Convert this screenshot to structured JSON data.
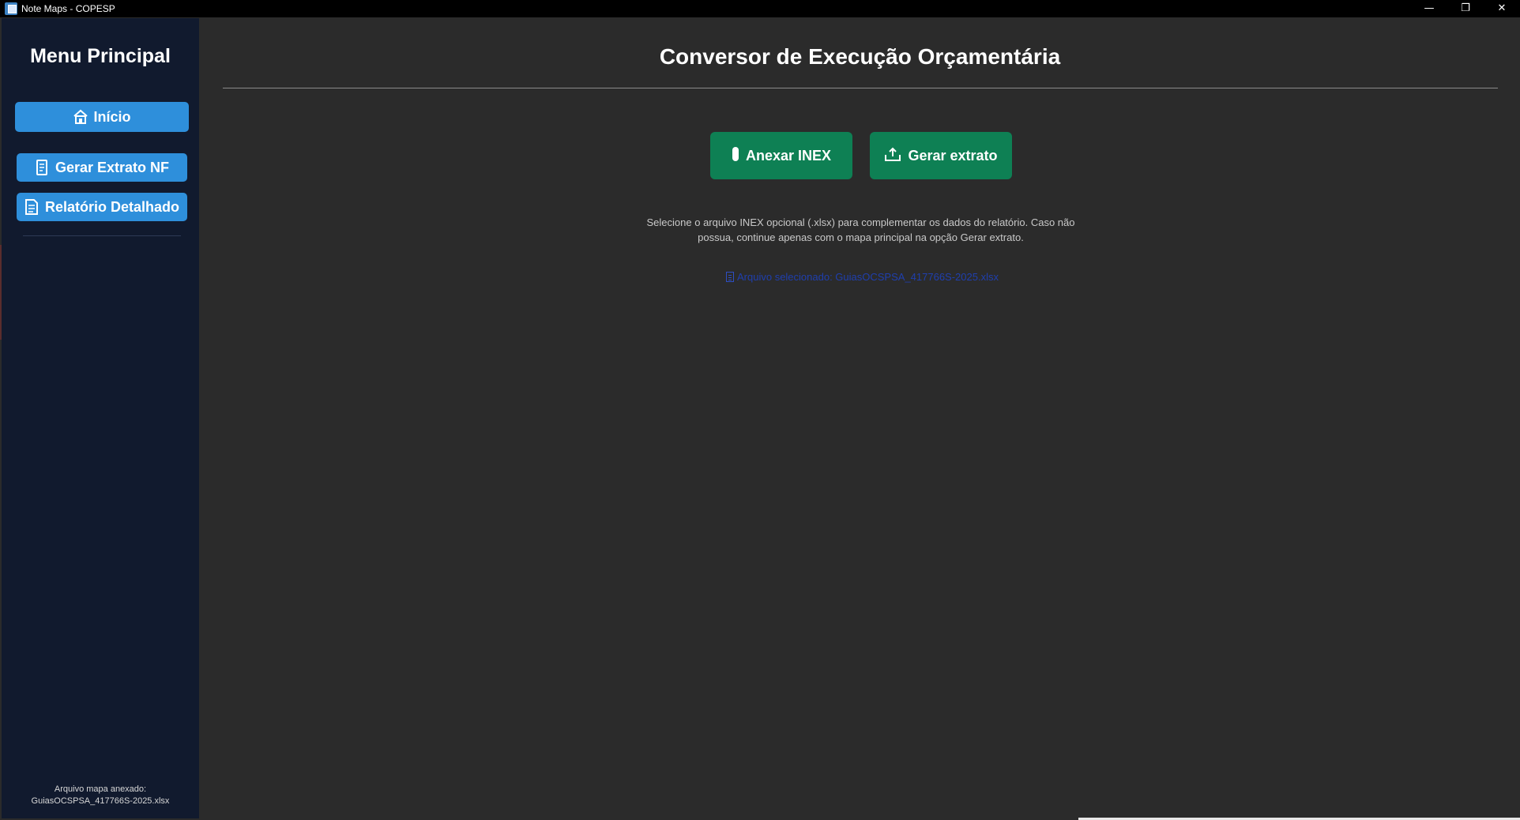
{
  "window": {
    "title": "Note Maps - COPESP",
    "controls": {
      "minimize": "—",
      "restore": "❐",
      "close": "✕"
    }
  },
  "sidebar": {
    "title": "Menu Principal",
    "items": [
      {
        "label": "Início",
        "icon": "home-icon"
      },
      {
        "label": "Gerar Extrato NF",
        "icon": "receipt-icon"
      },
      {
        "label": "Relatório Detalhado",
        "icon": "document-icon"
      }
    ],
    "footer": {
      "line1": "Arquivo mapa anexado:",
      "line2": "GuiasOCSPSA_417766S-2025.xlsx"
    }
  },
  "main": {
    "title": "Conversor de Execução Orçamentária",
    "buttons": {
      "anexar": {
        "label": "Anexar INEX",
        "icon": "paperclip-icon"
      },
      "gerar": {
        "label": "Gerar extrato",
        "icon": "upload-tray-icon"
      }
    },
    "help": {
      "line1": "Selecione o arquivo INEX opcional (.xlsx) para complementar os dados do relatório. Caso não",
      "line2": "possua, continue apenas com o mapa principal na opção Gerar extrato."
    },
    "selected_file": "Arquivo selecionado: GuiasOCSPSA_417766S-2025.xlsx"
  },
  "colors": {
    "sidebar_bg": "#111a2e",
    "main_bg": "#2b2b2b",
    "sidebar_button": "#2e8fdb",
    "action_button": "#0e8054",
    "selected_file_text": "#1f3fae"
  }
}
